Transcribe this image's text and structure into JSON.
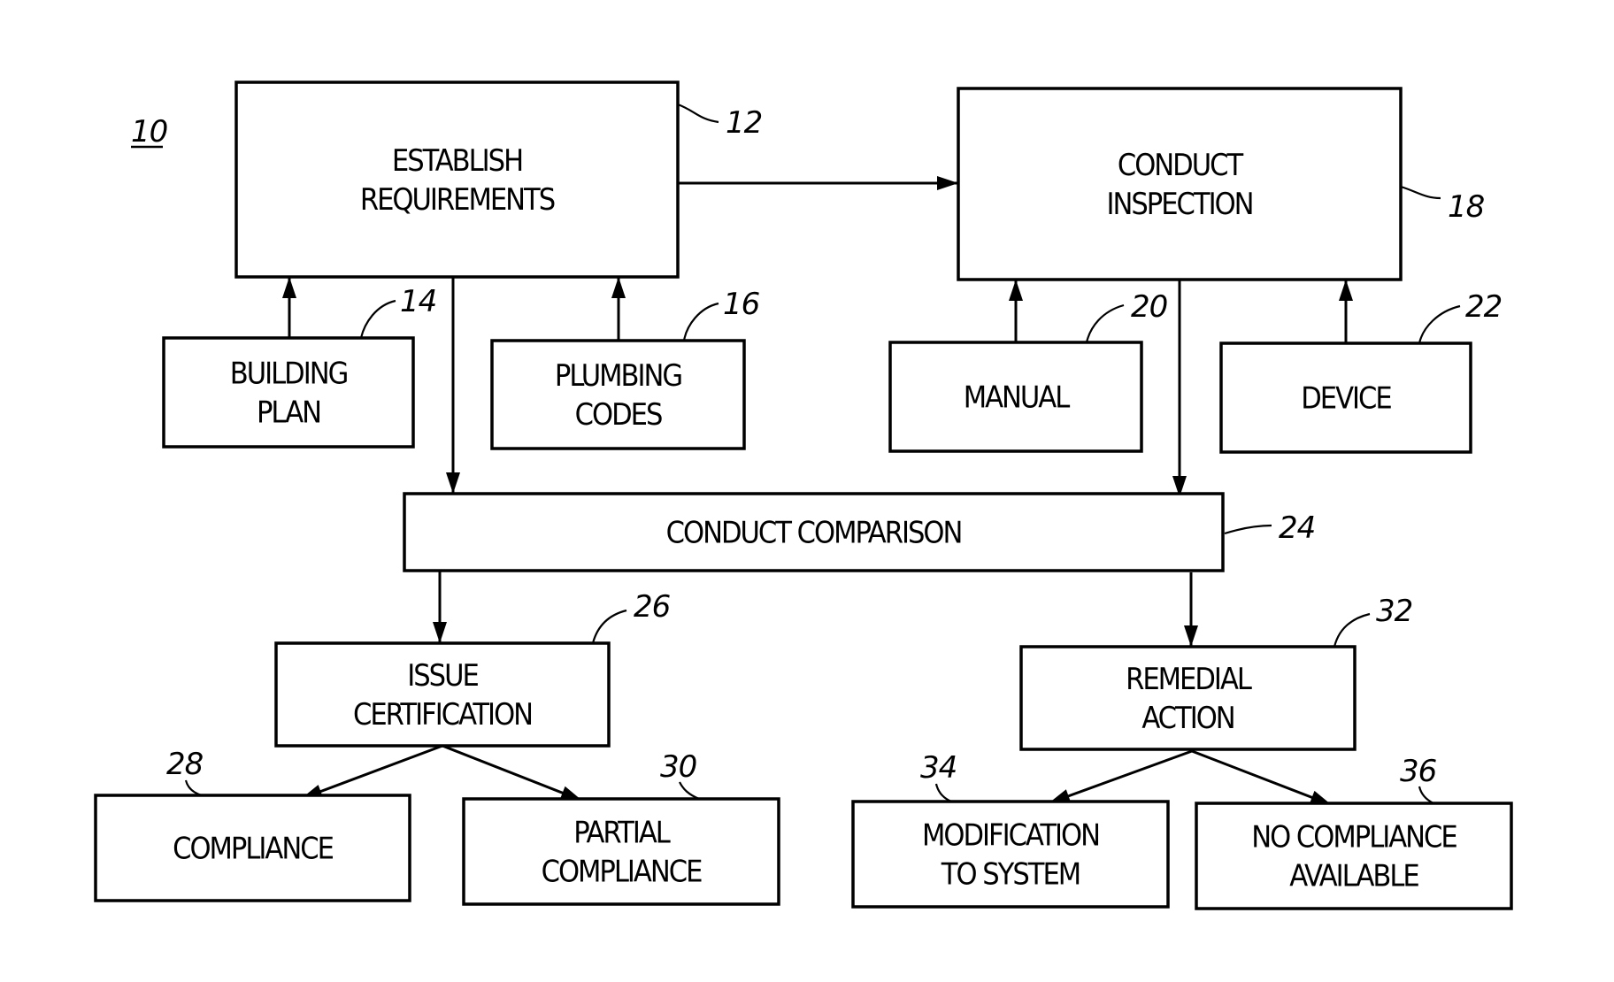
{
  "figure": {
    "ref": "10",
    "nodes": {
      "establish": {
        "ref": "12",
        "lines": [
          "ESTABLISH",
          "REQUIREMENTS"
        ]
      },
      "building_plan": {
        "ref": "14",
        "lines": [
          "BUILDING",
          "PLAN"
        ]
      },
      "plumbing_codes": {
        "ref": "16",
        "lines": [
          "PLUMBING",
          "CODES"
        ]
      },
      "inspection": {
        "ref": "18",
        "lines": [
          "CONDUCT",
          "INSPECTION"
        ]
      },
      "manual": {
        "ref": "20",
        "lines": [
          "MANUAL"
        ]
      },
      "device": {
        "ref": "22",
        "lines": [
          "DEVICE"
        ]
      },
      "comparison": {
        "ref": "24",
        "lines": [
          "CONDUCT COMPARISON"
        ]
      },
      "certification": {
        "ref": "26",
        "lines": [
          "ISSUE",
          "CERTIFICATION"
        ]
      },
      "compliance": {
        "ref": "28",
        "lines": [
          "COMPLIANCE"
        ]
      },
      "partial": {
        "ref": "30",
        "lines": [
          "PARTIAL",
          "COMPLIANCE"
        ]
      },
      "remedial": {
        "ref": "32",
        "lines": [
          "REMEDIAL",
          "ACTION"
        ]
      },
      "modification": {
        "ref": "34",
        "lines": [
          "MODIFICATION",
          "TO SYSTEM"
        ]
      },
      "no_compliance": {
        "ref": "36",
        "lines": [
          "NO COMPLIANCE",
          "AVAILABLE"
        ]
      }
    },
    "edges": [
      {
        "from": "building_plan",
        "to": "establish"
      },
      {
        "from": "plumbing_codes",
        "to": "establish"
      },
      {
        "from": "establish",
        "to": "inspection"
      },
      {
        "from": "manual",
        "to": "inspection"
      },
      {
        "from": "device",
        "to": "inspection"
      },
      {
        "from": "establish",
        "to": "comparison"
      },
      {
        "from": "inspection",
        "to": "comparison"
      },
      {
        "from": "comparison",
        "to": "certification"
      },
      {
        "from": "comparison",
        "to": "remedial"
      },
      {
        "from": "certification",
        "to": "compliance"
      },
      {
        "from": "certification",
        "to": "partial"
      },
      {
        "from": "remedial",
        "to": "modification"
      },
      {
        "from": "remedial",
        "to": "no_compliance"
      }
    ]
  }
}
